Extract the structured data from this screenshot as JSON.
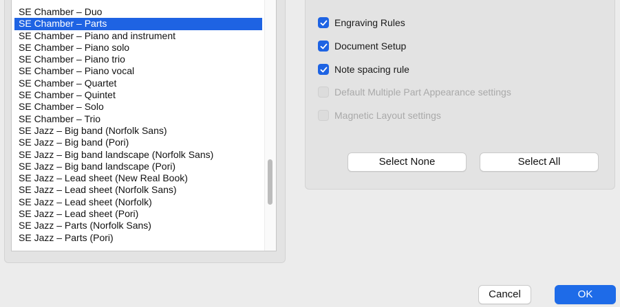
{
  "template_list": {
    "items": [
      "SE Chamber – Duo",
      "SE Chamber – Parts",
      "SE Chamber – Piano and instrument",
      "SE Chamber – Piano solo",
      "SE Chamber – Piano trio",
      "SE Chamber – Piano vocal",
      "SE Chamber – Quartet",
      "SE Chamber – Quintet",
      "SE Chamber – Solo",
      "SE Chamber – Trio",
      "SE Jazz – Big band (Norfolk Sans)",
      "SE Jazz – Big band (Pori)",
      "SE Jazz – Big band landscape (Norfolk Sans)",
      "SE Jazz – Big band landscape (Pori)",
      "SE Jazz – Lead sheet (New Real Book)",
      "SE Jazz – Lead sheet (Norfolk Sans)",
      "SE Jazz – Lead sheet (Norfolk)",
      "SE Jazz – Lead sheet (Pori)",
      "SE Jazz – Parts (Norfolk Sans)",
      "SE Jazz – Parts (Pori)"
    ],
    "selected_index": 1,
    "scroll_position": 0.62
  },
  "options": {
    "engraving_rules": {
      "label": "Engraving Rules",
      "checked": true,
      "enabled": true
    },
    "document_setup": {
      "label": "Document Setup",
      "checked": true,
      "enabled": true
    },
    "note_spacing_rule": {
      "label": "Note spacing rule",
      "checked": true,
      "enabled": true
    },
    "default_multiple_part_appearance": {
      "label": "Default Multiple Part Appearance settings",
      "checked": false,
      "enabled": false
    },
    "magnetic_layout": {
      "label": "Magnetic Layout settings",
      "checked": false,
      "enabled": false
    }
  },
  "buttons": {
    "select_none": "Select None",
    "select_all": "Select All",
    "cancel": "Cancel",
    "ok": "OK"
  },
  "colors": {
    "accent": "#1e63e3",
    "selection_text": "#ffffff",
    "disabled_text": "#a9a9a9"
  }
}
